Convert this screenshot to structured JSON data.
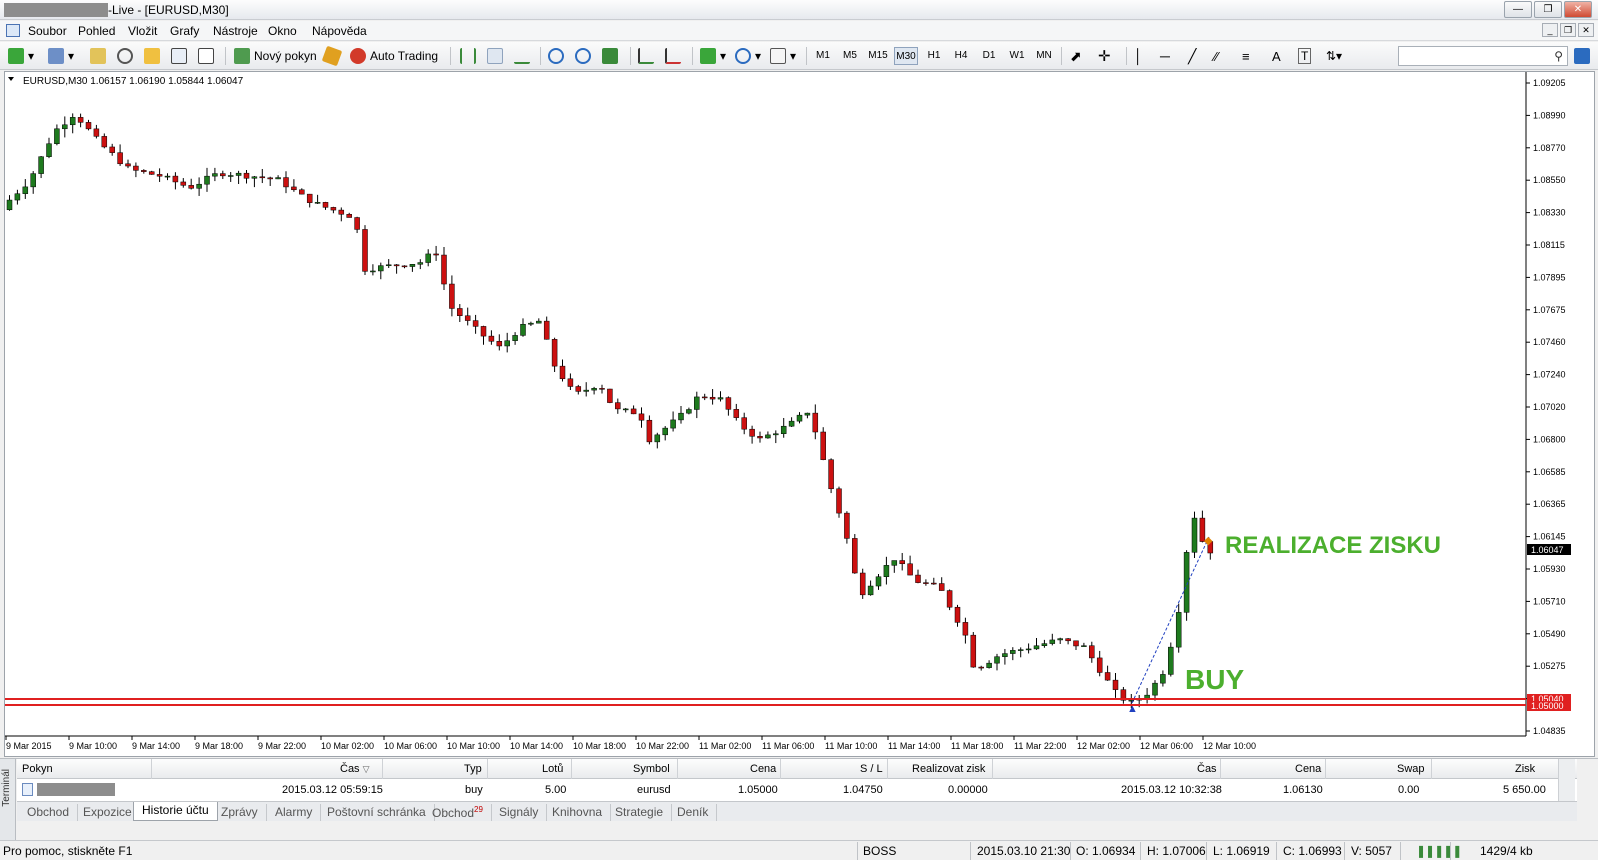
{
  "window": {
    "title": "-Live - [EURUSD,M30]"
  },
  "menu": [
    "Soubor",
    "Pohled",
    "Vložit",
    "Grafy",
    "Nástroje",
    "Okno",
    "Nápověda"
  ],
  "toolbar": {
    "new_order": "Nový pokyn",
    "auto_trading": "Auto Trading",
    "timeframes": [
      "M1",
      "M5",
      "M15",
      "M30",
      "H1",
      "H4",
      "D1",
      "W1",
      "MN"
    ],
    "active_timeframe": "M30",
    "draw_text_a": "A",
    "draw_text_t": "T"
  },
  "chart": {
    "header": "EURUSD,M30  1.06157 1.06190 1.05844 1.06047",
    "price_labels": [
      "1.09205",
      "1.08990",
      "1.08770",
      "1.08550",
      "1.08330",
      "1.08115",
      "1.07895",
      "1.07675",
      "1.07460",
      "1.07240",
      "1.07020",
      "1.06800",
      "1.06585",
      "1.06365",
      "1.06145",
      "1.05930",
      "1.05710",
      "1.05490",
      "1.05275",
      "1.05055",
      "1.04835"
    ],
    "current_price": "1.06047",
    "line_label_a": "1.05040",
    "line_label_b": "1.05000",
    "time_labels": [
      "9 Mar 2015",
      "9 Mar 10:00",
      "9 Mar 14:00",
      "9 Mar 18:00",
      "9 Mar 22:00",
      "10 Mar 02:00",
      "10 Mar 06:00",
      "10 Mar 10:00",
      "10 Mar 14:00",
      "10 Mar 18:00",
      "10 Mar 22:00",
      "11 Mar 02:00",
      "11 Mar 06:00",
      "11 Mar 10:00",
      "11 Mar 14:00",
      "11 Mar 18:00",
      "11 Mar 22:00",
      "12 Mar 02:00",
      "12 Mar 06:00",
      "12 Mar 10:00"
    ],
    "annotation_profit": "REALIZACE ZISKU",
    "annotation_buy": "BUY",
    "colors": {
      "bull": "#1e7a1e",
      "bear": "#cc1010",
      "annotation": "#4caf2e",
      "level_line": "#e02020"
    }
  },
  "terminal": {
    "side_label": "Terminál",
    "columns": [
      "Pokyn",
      "Čas",
      "Typ",
      "Lotů",
      "Symbol",
      "Cena",
      "S / L",
      "Realizovat zisk",
      "Čas",
      "Cena",
      "Swap",
      "Zisk"
    ],
    "row": {
      "time_open": "2015.03.12 05:59:15",
      "type": "buy",
      "lots": "5.00",
      "symbol": "eurusd",
      "price_open": "1.05000",
      "sl": "1.04750",
      "tp": "0.00000",
      "time_close": "2015.03.12 10:32:38",
      "price_close": "1.06130",
      "swap": "0.00",
      "profit": "5 650.00"
    },
    "tabs": [
      "Obchod",
      "Expozice",
      "Historie účtu",
      "Zprávy",
      "Alarmy",
      "Poštovní schránka",
      "Obchod",
      "Signály",
      "Knihovna",
      "Strategie",
      "Deník"
    ],
    "active_tab": "Historie účtu",
    "trade_badge": "29"
  },
  "status": {
    "help": "Pro pomoc, stiskněte F1",
    "profile": "BOSS",
    "datetime": "2015.03.10 21:30",
    "open": "O: 1.06934",
    "high": "H: 1.07006",
    "low": "L: 1.06919",
    "close": "C: 1.06993",
    "volume": "V: 5057",
    "traffic": "1429/4 kb"
  }
}
